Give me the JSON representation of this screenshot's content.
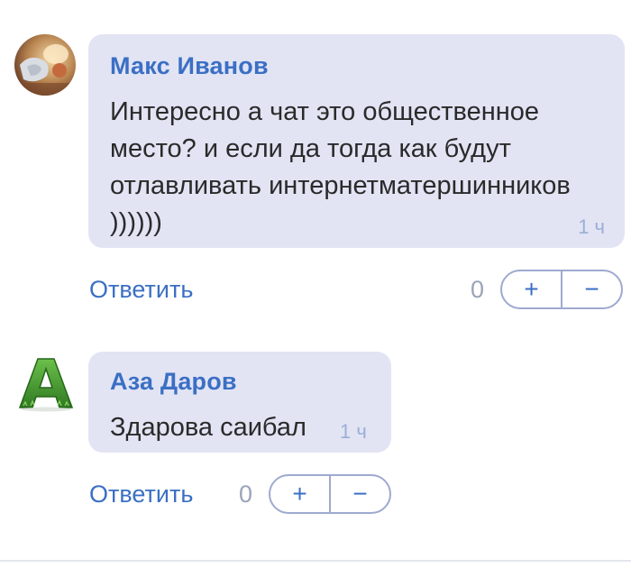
{
  "comments": [
    {
      "author": "Макс Иванов",
      "text": "Интересно а чат это общественное место? и если да тогда как будут отлавливать интернетматершинников ))))))",
      "time": "1 ч",
      "reply_label": "Ответить",
      "score": "0",
      "plus_label": "+",
      "minus_label": "−",
      "avatar_icon": "profile-photo"
    },
    {
      "author": "Аза Даров",
      "text": "Здарова саибал",
      "time": "1 ч",
      "reply_label": "Ответить",
      "score": "0",
      "plus_label": "+",
      "minus_label": "−",
      "avatar_letter": "A",
      "avatar_icon": "grass-letter-a"
    }
  ],
  "colors": {
    "bubble": "#e2e4f4",
    "author": "#3b6fc4",
    "time": "#9aaed6",
    "avatar_letter": "#3f8f2c"
  }
}
